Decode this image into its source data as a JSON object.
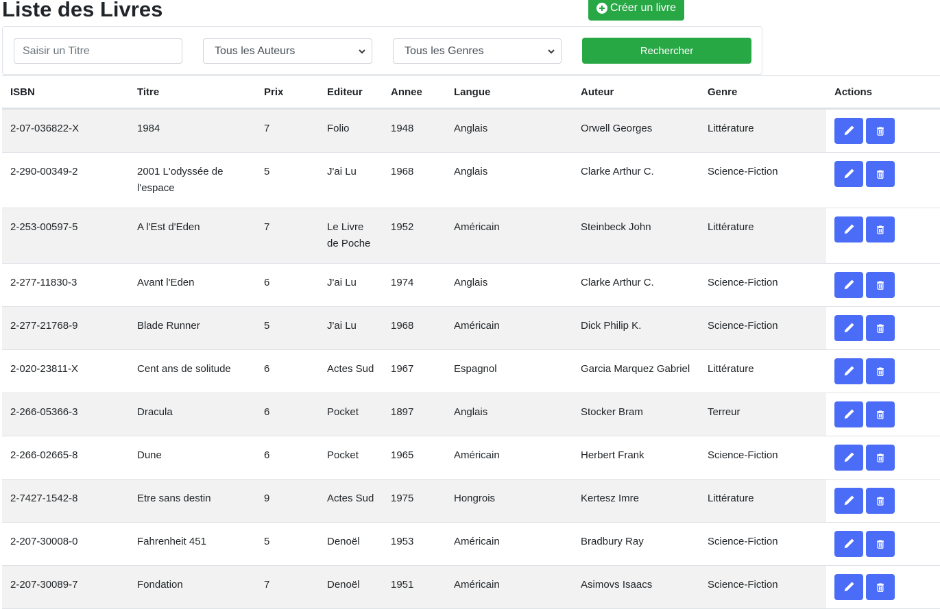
{
  "page": {
    "title": "Liste des Livres",
    "create_button_label": "Créer un livre"
  },
  "search": {
    "title_placeholder": "Saisir un Titre",
    "author_selected": "Tous les Auteurs",
    "genre_selected": "Tous les Genres",
    "submit_label": "Rechercher"
  },
  "table": {
    "columns": [
      "ISBN",
      "Titre",
      "Prix",
      "Editeur",
      "Annee",
      "Langue",
      "Auteur",
      "Genre",
      "Actions"
    ],
    "rows": [
      {
        "isbn": "2-07-036822-X",
        "titre": "1984",
        "prix": "7",
        "editeur": "Folio",
        "annee": "1948",
        "langue": "Anglais",
        "auteur": "Orwell  Georges",
        "genre": "Littérature"
      },
      {
        "isbn": "2-290-00349-2",
        "titre": "2001 L'odyssée de l'espace",
        "prix": "5",
        "editeur": "J'ai Lu",
        "annee": "1968",
        "langue": "Anglais",
        "auteur": "Clarke  Arthur C.",
        "genre": "Science-Fiction"
      },
      {
        "isbn": "2-253-00597-5",
        "titre": "A l'Est d'Eden",
        "prix": "7",
        "editeur": "Le Livre de Poche",
        "annee": "1952",
        "langue": "Américain",
        "auteur": "Steinbeck  John",
        "genre": "Littérature"
      },
      {
        "isbn": "2-277-11830-3",
        "titre": "Avant l'Eden",
        "prix": "6",
        "editeur": "J'ai Lu",
        "annee": "1974",
        "langue": "Anglais",
        "auteur": "Clarke  Arthur C.",
        "genre": "Science-Fiction"
      },
      {
        "isbn": "2-277-21768-9",
        "titre": "Blade Runner",
        "prix": "5",
        "editeur": "J'ai Lu",
        "annee": "1968",
        "langue": "Américain",
        "auteur": "Dick  Philip K.",
        "genre": "Science-Fiction"
      },
      {
        "isbn": "2-020-23811-X",
        "titre": "Cent ans de solitude",
        "prix": "6",
        "editeur": "Actes Sud",
        "annee": "1967",
        "langue": "Espagnol",
        "auteur": "Garcia Marquez  Gabriel",
        "genre": "Littérature"
      },
      {
        "isbn": "2-266-05366-3",
        "titre": "Dracula",
        "prix": "6",
        "editeur": "Pocket",
        "annee": "1897",
        "langue": "Anglais",
        "auteur": "Stocker  Bram",
        "genre": "Terreur"
      },
      {
        "isbn": "2-266-02665-8",
        "titre": "Dune",
        "prix": "6",
        "editeur": "Pocket",
        "annee": "1965",
        "langue": "Américain",
        "auteur": "Herbert  Frank",
        "genre": "Science-Fiction"
      },
      {
        "isbn": "2-7427-1542-8",
        "titre": "Etre sans destin",
        "prix": "9",
        "editeur": "Actes Sud",
        "annee": "1975",
        "langue": "Hongrois",
        "auteur": "Kertesz  Imre",
        "genre": "Littérature"
      },
      {
        "isbn": "2-207-30008-0",
        "titre": "Fahrenheit 451",
        "prix": "5",
        "editeur": "Denoël",
        "annee": "1953",
        "langue": "Américain",
        "auteur": "Bradbury  Ray",
        "genre": "Science-Fiction"
      },
      {
        "isbn": "2-207-30089-7",
        "titre": "Fondation",
        "prix": "7",
        "editeur": "Denoël",
        "annee": "1951",
        "langue": "Américain",
        "auteur": "Asimovs  Isaacs",
        "genre": "Science-Fiction"
      }
    ]
  },
  "icons": {
    "create": "plus-circle-icon",
    "edit": "pencil-icon",
    "delete": "trash-icon",
    "select": "chevron-down-icon"
  },
  "colors": {
    "success": "#28a745",
    "primary": "#4a6cf7",
    "stripe": "#f2f2f2"
  }
}
